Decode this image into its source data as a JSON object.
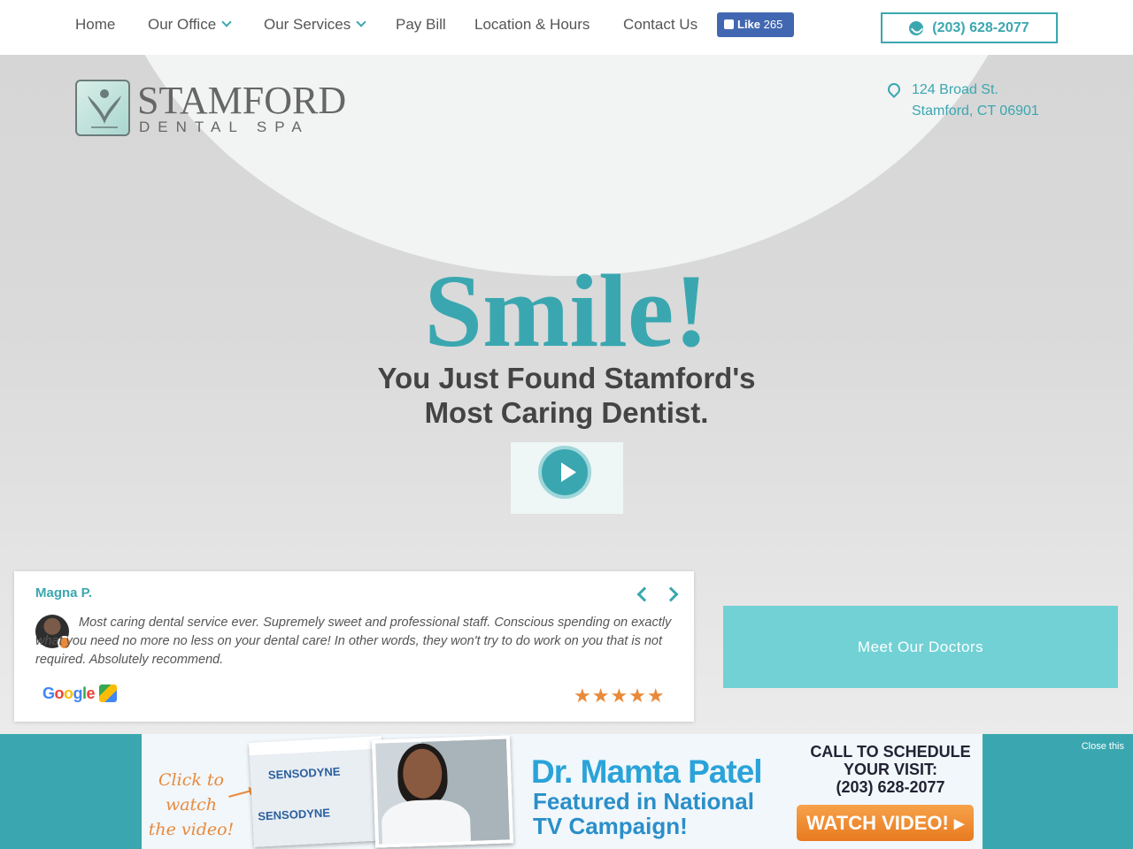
{
  "nav": {
    "items": [
      {
        "label": "Home",
        "dropdown": false
      },
      {
        "label": "Our Office",
        "dropdown": true
      },
      {
        "label": "Our Services",
        "dropdown": true
      },
      {
        "label": "Pay Bill",
        "dropdown": false
      },
      {
        "label": "Location & Hours",
        "dropdown": false
      },
      {
        "label": "Contact Us",
        "dropdown": false
      }
    ],
    "facebook_like": {
      "label": "Like",
      "count": "265"
    },
    "phone": "(203) 628-2077"
  },
  "brand": {
    "name": "STAMFORD",
    "subtitle": "DENTAL SPA"
  },
  "address": {
    "line1": "124 Broad St.",
    "line2": "Stamford, CT 06901"
  },
  "hero": {
    "headline": "Smile!",
    "tagline_line1": "You Just Found Stamford's",
    "tagline_line2": "Most Caring Dentist."
  },
  "review": {
    "reviewer": "Magna P.",
    "text": "Most caring dental service ever. Supremely sweet and professional staff. Conscious spending on exactly what you need no more no less on your dental care! In other words, they won't try to do work on you that is not required. Absolutely recommend.",
    "source": "Google",
    "rating": 5,
    "stars": "★★★★★"
  },
  "meet_button": "Meet Our Doctors",
  "banner": {
    "close_label": "Close this",
    "ad_click_line1": "Click to",
    "ad_click_line2": "watch",
    "ad_click_line3": "the video!",
    "product_label": "SENSODYNE",
    "doctor_name": "Dr. Mamta Patel",
    "feature_line1": "Featured in National",
    "feature_line2": "TV Campaign!",
    "call_line1": "CALL TO SCHEDULE",
    "call_line2": "YOUR VISIT:",
    "call_phone": "(203) 628-2077",
    "watch_label": "WATCH VIDEO! ▸"
  },
  "colors": {
    "accent": "#3aa7b0",
    "meet_button": "#72d1d5",
    "star": "#e98a3a",
    "facebook": "#4267b2"
  },
  "icons": [
    "chevron-down-icon",
    "thumbs-up-icon",
    "phone-icon",
    "location-pin-icon",
    "play-icon",
    "chevron-left-icon",
    "chevron-right-icon",
    "google-maps-icon",
    "star-icon"
  ]
}
